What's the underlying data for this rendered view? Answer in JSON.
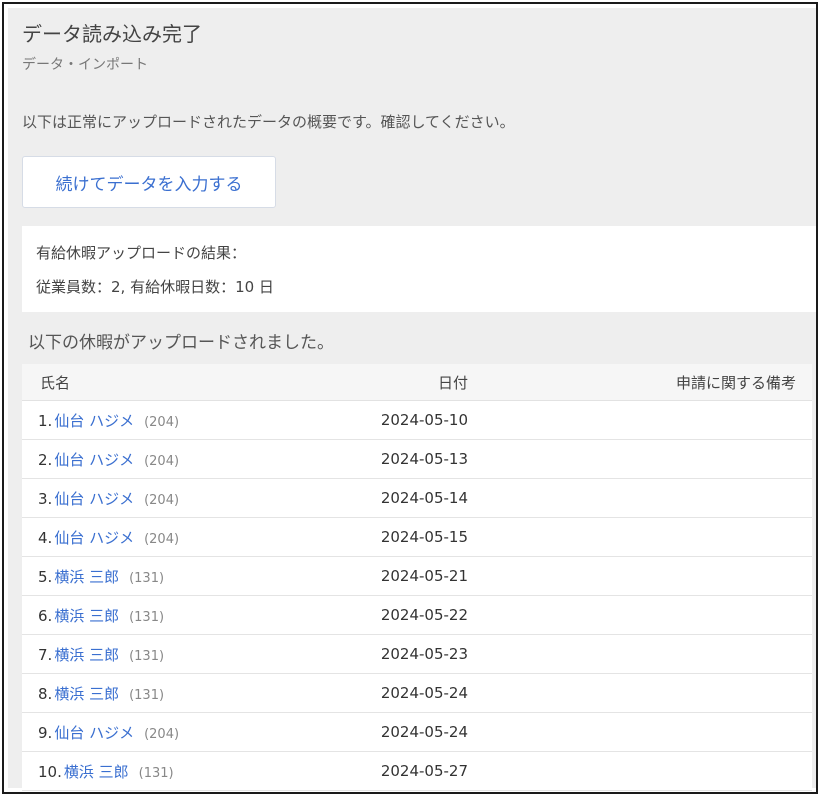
{
  "header": {
    "title": "データ読み込み完了",
    "subtitle": "データ・インポート"
  },
  "intro": "以下は正常にアップロードされたデータの概要です。確認してください。",
  "continue_button_label": "続けてデータを入力する",
  "summary": {
    "heading": "有給休暇アップロードの結果：",
    "counts": "従業員数：2, 有給休暇日数：10 日"
  },
  "section_title": "以下の休暇がアップロードされました。",
  "table": {
    "columns": [
      "氏名",
      "日付",
      "申請に関する備考"
    ],
    "rows": [
      {
        "index": "1.",
        "name": "仙台 ハジメ",
        "id": "(204)",
        "date": "2024-05-10",
        "note": ""
      },
      {
        "index": "2.",
        "name": "仙台 ハジメ",
        "id": "(204)",
        "date": "2024-05-13",
        "note": ""
      },
      {
        "index": "3.",
        "name": "仙台 ハジメ",
        "id": "(204)",
        "date": "2024-05-14",
        "note": ""
      },
      {
        "index": "4.",
        "name": "仙台 ハジメ",
        "id": "(204)",
        "date": "2024-05-15",
        "note": ""
      },
      {
        "index": "5.",
        "name": "横浜 三郎",
        "id": "(131)",
        "date": "2024-05-21",
        "note": ""
      },
      {
        "index": "6.",
        "name": "横浜 三郎",
        "id": "(131)",
        "date": "2024-05-22",
        "note": ""
      },
      {
        "index": "7.",
        "name": "横浜 三郎",
        "id": "(131)",
        "date": "2024-05-23",
        "note": ""
      },
      {
        "index": "8.",
        "name": "横浜 三郎",
        "id": "(131)",
        "date": "2024-05-24",
        "note": ""
      },
      {
        "index": "9.",
        "name": "仙台 ハジメ",
        "id": "(204)",
        "date": "2024-05-24",
        "note": ""
      },
      {
        "index": "10.",
        "name": "横浜 三郎",
        "id": "(131)",
        "date": "2024-05-27",
        "note": ""
      }
    ]
  },
  "colors": {
    "link": "#3a6fd0",
    "background": "#eeeeee",
    "frame_border": "#1a1a1a"
  }
}
